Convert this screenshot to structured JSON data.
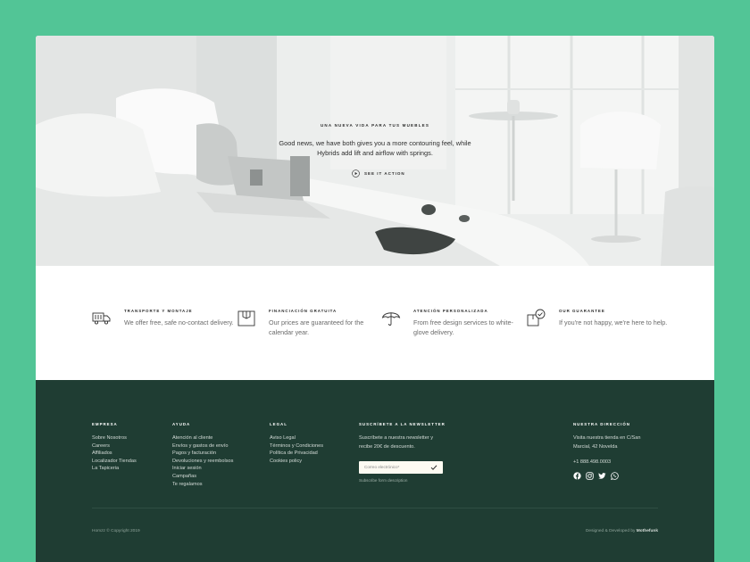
{
  "hero": {
    "eyebrow": "UNA NUEVA VIDA PARA TUS MUEBLES",
    "text": "Good news, we have both gives you a more contouring feel, while Hybrids add lift and airflow with springs.",
    "cta_label": "SEE IT ACTION",
    "cta_icon": "play-circle-icon"
  },
  "features": [
    {
      "icon": "truck-icon",
      "title": "TRANSPORTE Y MONTAJE",
      "text": "We offer free, safe no-contact delivery."
    },
    {
      "icon": "gift-box-icon",
      "title": "FINANCIACIÓN GRATUITA",
      "text": "Our prices are guaranteed for the calendar year."
    },
    {
      "icon": "umbrella-icon",
      "title": "ATENCIÓN PERSONALIZADA",
      "text": "From free design services to white-glove delivery."
    },
    {
      "icon": "box-check-icon",
      "title": "OUR GUARANTEE",
      "text": "If you're not happy, we're here to help."
    }
  ],
  "footer": {
    "empresa": {
      "title": "EMPRESA",
      "links": [
        "Sobre Nosotros",
        "Careers",
        "Affiliados",
        "Localizador Tiendas",
        "La Tapiceria"
      ]
    },
    "ayuda": {
      "title": "AYUDA",
      "links": [
        "Atención al cliente",
        "Envíos y gastos de envío",
        "Pagos y facturación",
        "Devoluciones y reembolsos",
        "Iniciar sesión",
        "Campañas",
        "Te regalamos"
      ]
    },
    "legal": {
      "title": "LEGAL",
      "links": [
        "Aviso Legal",
        "Términos y Condiciones",
        "Política de Privacidad",
        "Cookies policy"
      ]
    },
    "newsletter": {
      "title": "SUSCRÍBETE A LA NEWSLETTER",
      "text": "Suscríbete a nuestra newsletter y recibe 20€ de descuento.",
      "placeholder": "Correo electrónico*",
      "description": "Subscribe form description"
    },
    "address": {
      "title": "NUESTRA DIRECCIÓN",
      "text": "Visita nuestra tienda en C/San Marcial, 42 Novelda",
      "phone": "+1 888.498.0003",
      "socials": [
        "facebook-icon",
        "instagram-icon",
        "twitter-icon",
        "whatsapp-icon"
      ]
    },
    "copyright": "Homzz © Copyright 2019",
    "credits_prefix": "Designed & Developed by",
    "credits_name": "Mothefunk"
  },
  "colors": {
    "background": "#52c596",
    "footer": "#1f3d33",
    "hero": "#e9ebea"
  }
}
